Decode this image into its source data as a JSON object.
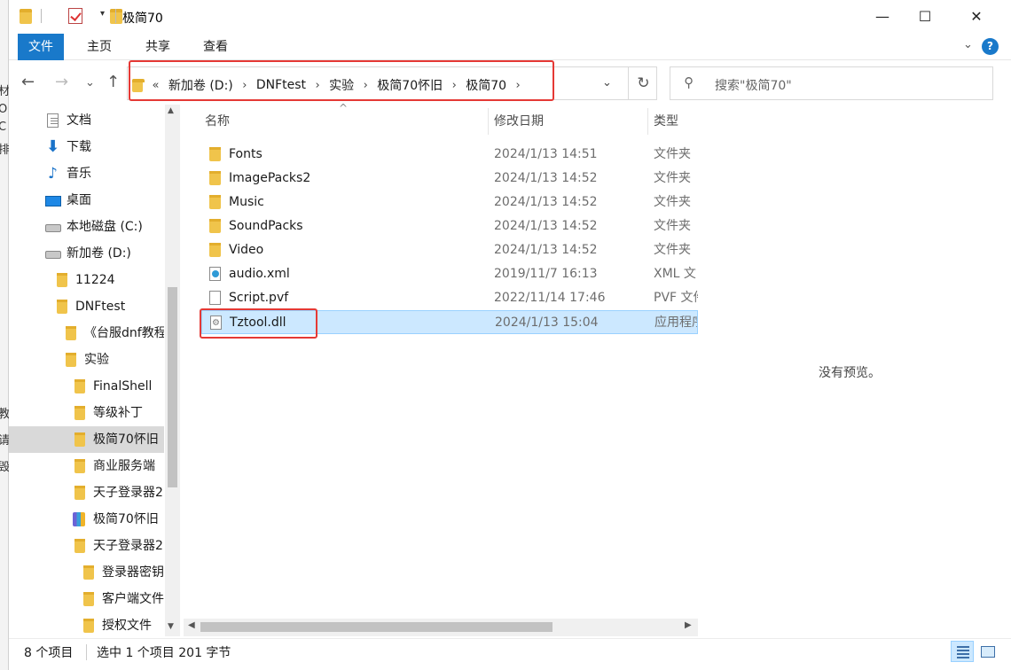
{
  "window": {
    "title": "极简70",
    "dropdown_glyph": "▾",
    "minimize": "—",
    "maximize": "☐",
    "close": "✕"
  },
  "ribbon": {
    "tabs": [
      "文件",
      "主页",
      "共享",
      "查看"
    ],
    "collapse_glyph": "⌄",
    "help_glyph": "?"
  },
  "nav": {
    "back": "←",
    "forward": "→",
    "recent": "⌄",
    "up": "↑"
  },
  "address": {
    "overflow": "«",
    "crumbs": [
      "新加卷 (D:)",
      "DNFtest",
      "实验",
      "极简70怀旧",
      "极简70"
    ],
    "separator": "›",
    "dropdown": "⌄",
    "refresh": "↻"
  },
  "search": {
    "placeholder": "搜索\"极简70\"",
    "icon": "⚲"
  },
  "sidebar": {
    "items": [
      {
        "label": "文档",
        "icon": "doc"
      },
      {
        "label": "下载",
        "icon": "download"
      },
      {
        "label": "音乐",
        "icon": "music"
      },
      {
        "label": "桌面",
        "icon": "desktop"
      },
      {
        "label": "本地磁盘 (C:)",
        "icon": "drive"
      },
      {
        "label": "新加卷 (D:)",
        "icon": "drive"
      },
      {
        "label": "11224",
        "icon": "folder"
      },
      {
        "label": "DNFtest",
        "icon": "folder"
      },
      {
        "label": "《台服dnf教程",
        "icon": "folder"
      },
      {
        "label": "实验",
        "icon": "folder"
      },
      {
        "label": "FinalShell",
        "icon": "folder"
      },
      {
        "label": "等级补丁",
        "icon": "folder"
      },
      {
        "label": "极简70怀旧",
        "icon": "folder",
        "selected": true
      },
      {
        "label": "商业服务端",
        "icon": "folder"
      },
      {
        "label": "天子登录器2",
        "icon": "folder"
      },
      {
        "label": "极简70怀旧",
        "icon": "zip"
      },
      {
        "label": "天子登录器2",
        "icon": "folder"
      },
      {
        "label": "登录器密钥",
        "icon": "folder"
      },
      {
        "label": "客户端文件",
        "icon": "folder"
      },
      {
        "label": "授权文件",
        "icon": "folder"
      }
    ]
  },
  "columns": {
    "name": "名称",
    "date": "修改日期",
    "type": "类型",
    "sort_glyph": "^"
  },
  "files": [
    {
      "name": "Fonts",
      "date": "2024/1/13 14:51",
      "type": "文件夹",
      "icon": "folder"
    },
    {
      "name": "ImagePacks2",
      "date": "2024/1/13 14:52",
      "type": "文件夹",
      "icon": "folder"
    },
    {
      "name": "Music",
      "date": "2024/1/13 14:52",
      "type": "文件夹",
      "icon": "folder"
    },
    {
      "name": "SoundPacks",
      "date": "2024/1/13 14:52",
      "type": "文件夹",
      "icon": "folder"
    },
    {
      "name": "Video",
      "date": "2024/1/13 14:52",
      "type": "文件夹",
      "icon": "folder"
    },
    {
      "name": "audio.xml",
      "date": "2019/11/7 16:13",
      "type": "XML 文",
      "icon": "xml"
    },
    {
      "name": "Script.pvf",
      "date": "2022/11/14 17:46",
      "type": "PVF 文件",
      "icon": "file"
    },
    {
      "name": "Tztool.dll",
      "date": "2024/1/13 15:04",
      "type": "应用程序",
      "icon": "dll",
      "selected": true
    }
  ],
  "preview": {
    "empty_text": "没有预览。"
  },
  "status": {
    "item_count": "8 个项目",
    "selection": "选中 1 个项目  201 字节"
  },
  "colors": {
    "accent": "#1979ca",
    "selection_bg": "#cce8ff",
    "highlight_box": "#e53935"
  }
}
